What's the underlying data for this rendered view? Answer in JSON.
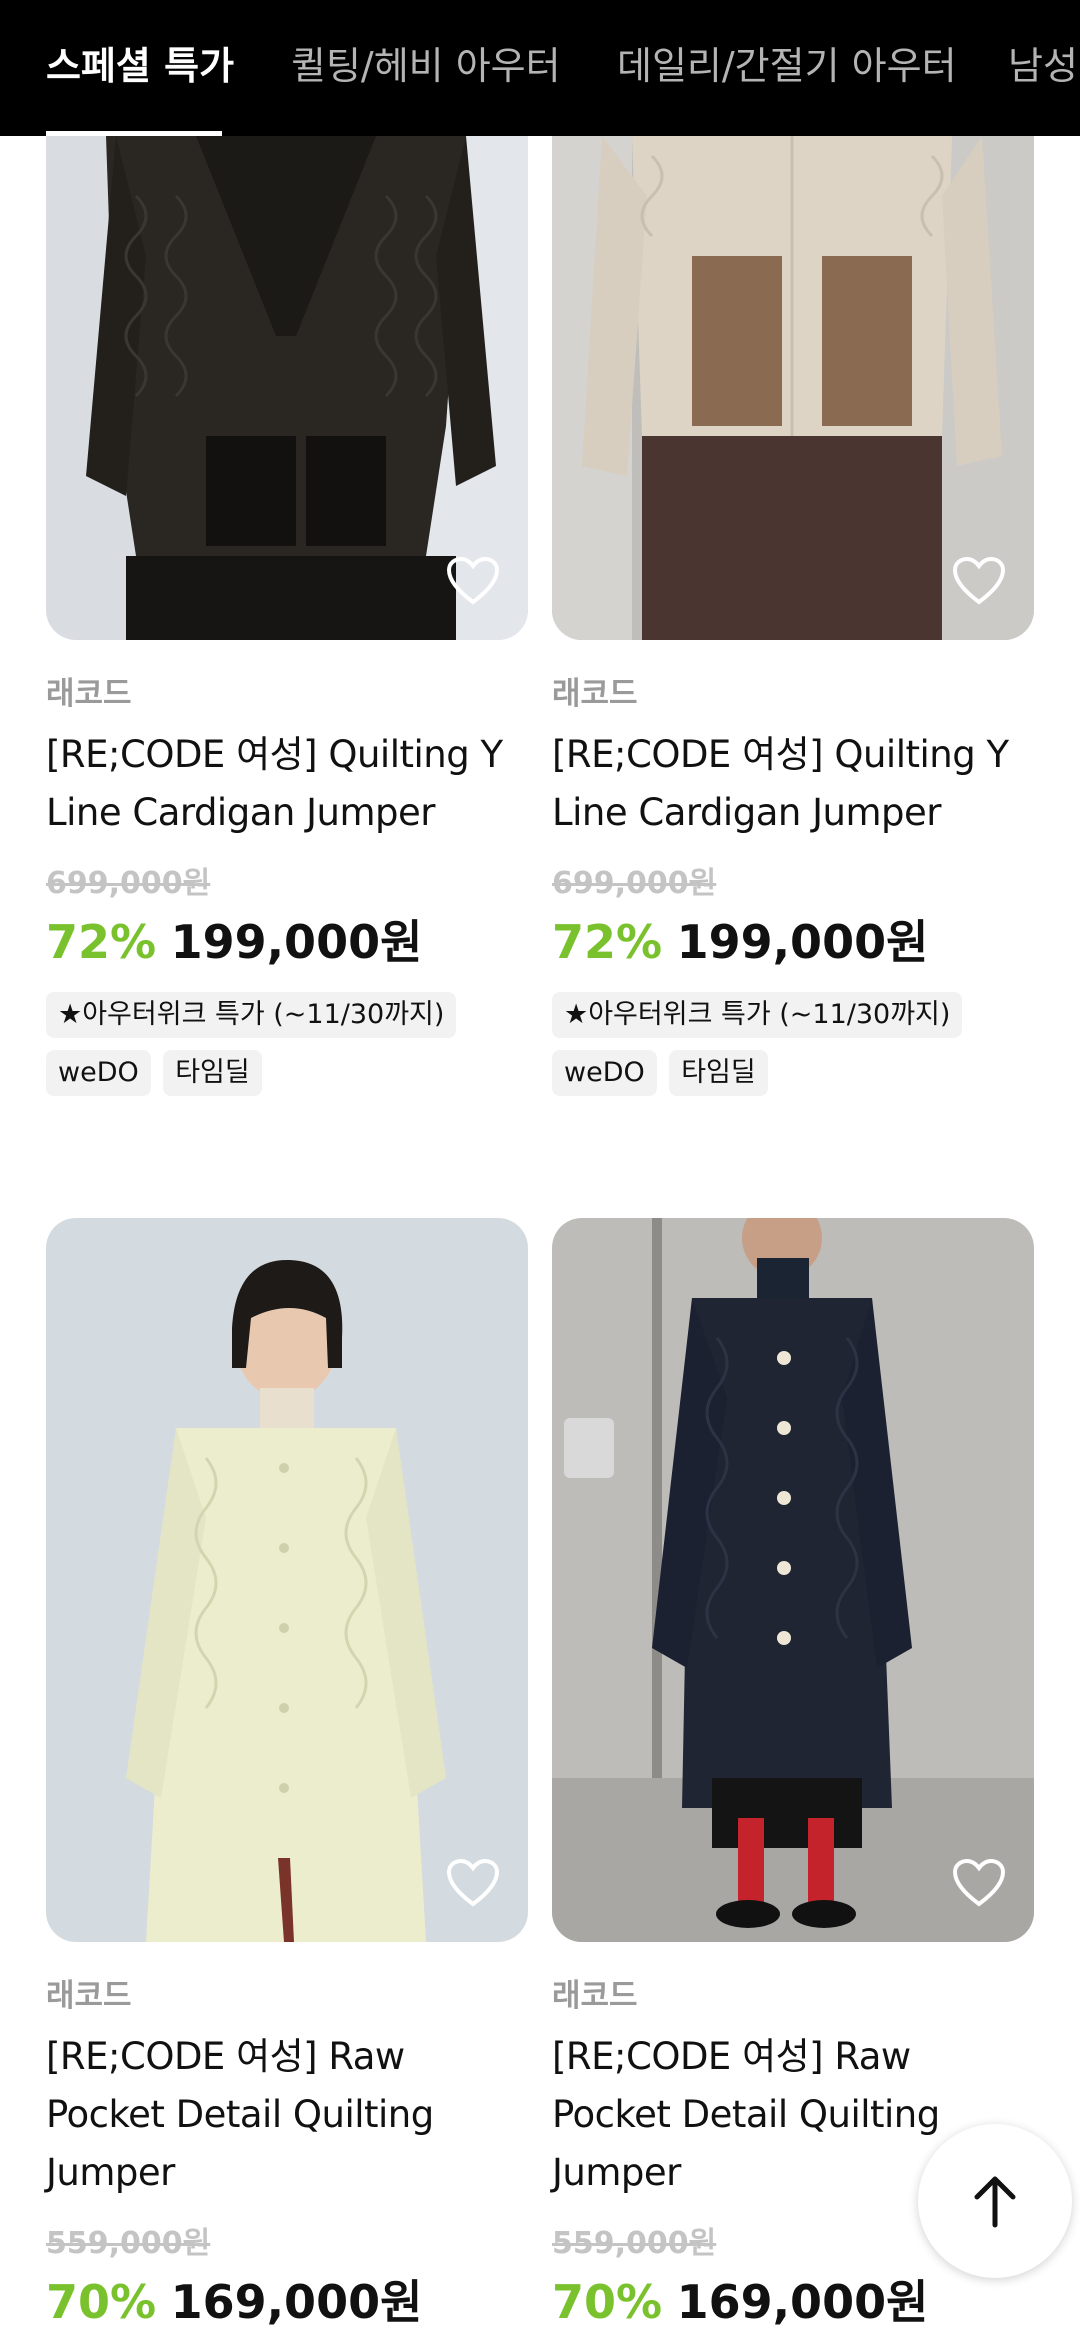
{
  "tabs": [
    {
      "label": "스페셜 특가",
      "active": true
    },
    {
      "label": "퀼팅/헤비 아우터",
      "active": false
    },
    {
      "label": "데일리/간절기 아우터",
      "active": false
    },
    {
      "label": "남성",
      "active": false
    }
  ],
  "products": [
    {
      "brand": "래코드",
      "title": "[RE;CODE 여성] Quilting Y Line Cardigan Jumper",
      "original_price": "699,000원",
      "discount": "72%",
      "price": "199,000원",
      "promo": "★아우터위크 특가 (~11/30까지)",
      "tags": [
        "weDO",
        "타임딜"
      ],
      "image": "black-quilted-cardigan-photo"
    },
    {
      "brand": "래코드",
      "title": "[RE;CODE 여성] Quilting Y Line Cardigan Jumper",
      "original_price": "699,000원",
      "discount": "72%",
      "price": "199,000원",
      "promo": "★아우터위크 특가 (~11/30까지)",
      "tags": [
        "weDO",
        "타임딜"
      ],
      "image": "beige-quilted-cardigan-photo"
    },
    {
      "brand": "래코드",
      "title": "[RE;CODE 여성] Raw Pocket Detail Quilting Jumper",
      "original_price": "559,000원",
      "discount": "70%",
      "price": "169,000원",
      "image": "cream-long-quilted-coat-photo"
    },
    {
      "brand": "래코드",
      "title": "[RE;CODE 여성] Raw Pocket Detail Quilting Jumper",
      "original_price": "559,000원",
      "discount": "70%",
      "price": "169,000원",
      "image": "black-long-quilted-coat-photo"
    }
  ],
  "icons": {
    "wishlist": "heart-outline-icon",
    "scroll_top": "arrow-up-icon"
  },
  "colors": {
    "discount": "#7ac22d",
    "tabbar_bg": "#000000",
    "chip_bg": "#f2f2f2"
  }
}
